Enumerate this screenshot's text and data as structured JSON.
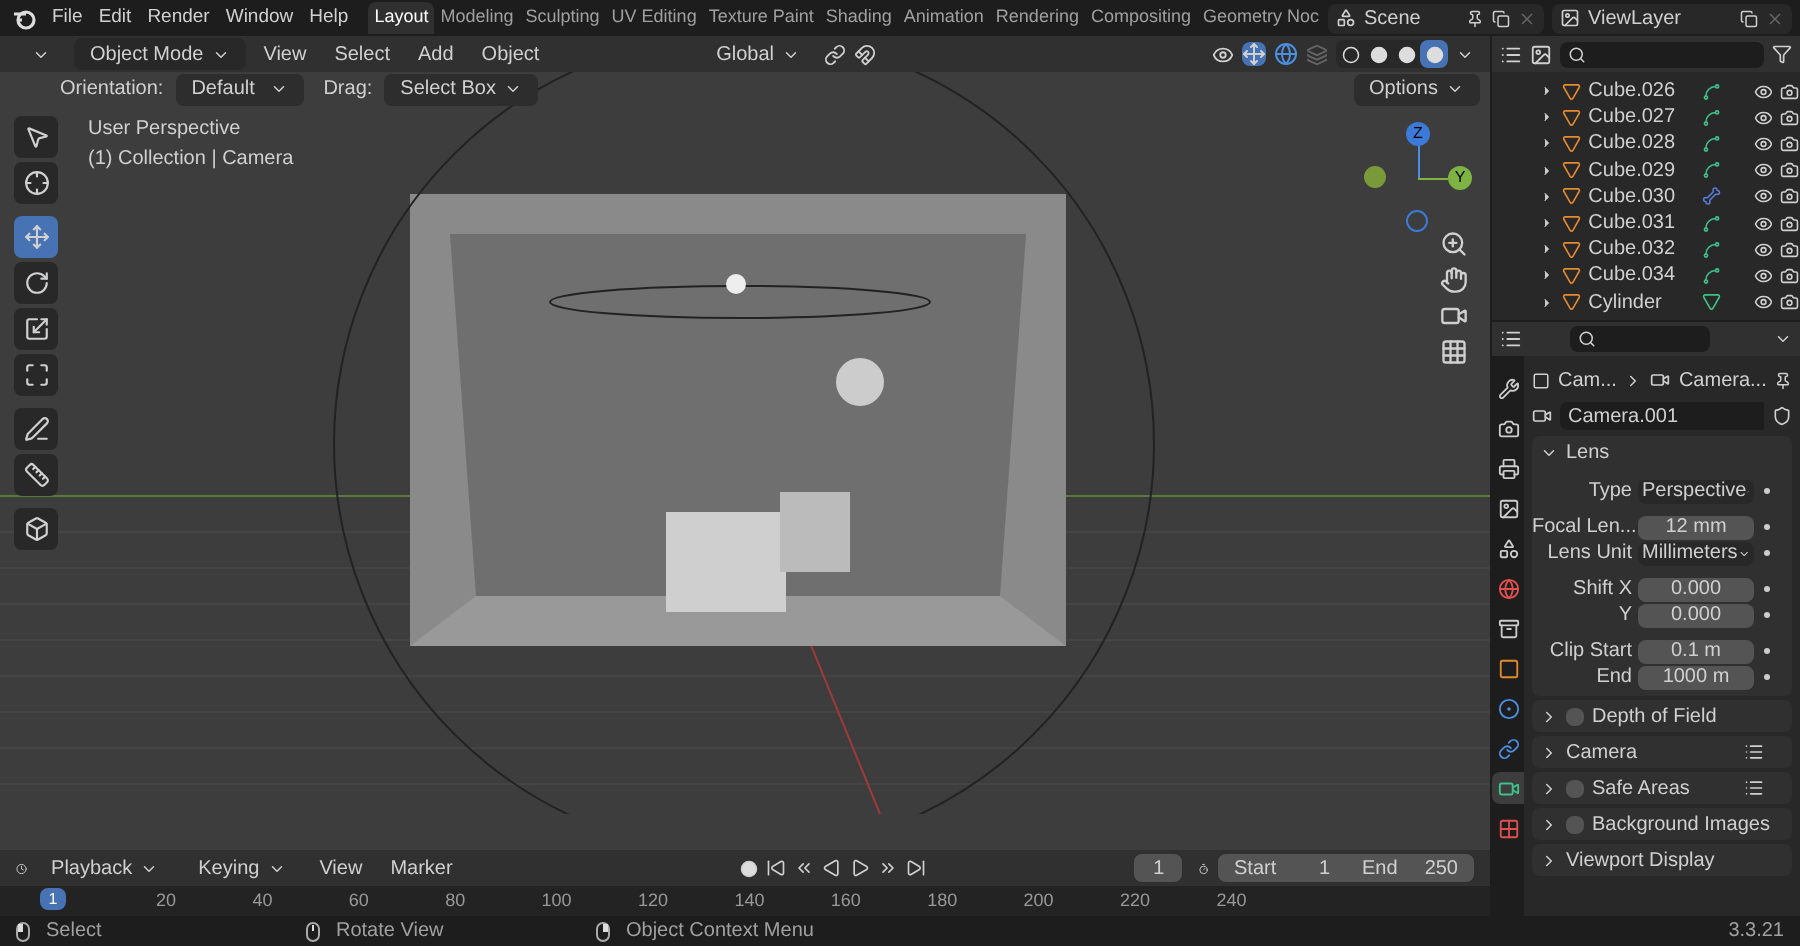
{
  "menu": [
    "File",
    "Edit",
    "Render",
    "Window",
    "Help"
  ],
  "workspaces": [
    {
      "label": "Layout",
      "selected": true
    },
    {
      "label": "Modeling",
      "selected": false
    },
    {
      "label": "Sculpting",
      "selected": false
    },
    {
      "label": "UV Editing",
      "selected": false
    },
    {
      "label": "Texture Paint",
      "selected": false
    },
    {
      "label": "Shading",
      "selected": false
    },
    {
      "label": "Animation",
      "selected": false
    },
    {
      "label": "Rendering",
      "selected": false
    },
    {
      "label": "Compositing",
      "selected": false
    },
    {
      "label": "Geometry Noc",
      "selected": false
    }
  ],
  "scene": "Scene",
  "view_layer": "ViewLayer",
  "viewport_header": {
    "mode": "Object Mode",
    "menus": [
      "View",
      "Select",
      "Add",
      "Object"
    ],
    "orientation": "Global",
    "shading": [
      {
        "kind": "wireframe",
        "selected": false
      },
      {
        "kind": "solid",
        "selected": false
      },
      {
        "kind": "material",
        "selected": false
      },
      {
        "kind": "rendered",
        "selected": true
      }
    ]
  },
  "tool_settings": {
    "orientation_label": "Orientation:",
    "orientation": "Default",
    "drag_label": "Drag:",
    "drag": "Select Box",
    "options": "Options"
  },
  "viewport": {
    "view_name": "User Perspective",
    "collection": "(1) Collection | Camera",
    "axes": {
      "y": "Y",
      "z": "Z"
    }
  },
  "toolbar": [
    {
      "kind": "select",
      "selected": false
    },
    {
      "kind": "cursor",
      "selected": false
    },
    {
      "kind": "move",
      "selected": true
    },
    {
      "kind": "rotate",
      "selected": false
    },
    {
      "kind": "scale",
      "selected": false
    },
    {
      "kind": "transform",
      "selected": false
    },
    {
      "kind": "annotate",
      "selected": false
    },
    {
      "kind": "measure",
      "selected": false
    },
    {
      "kind": "add-cube",
      "selected": false
    }
  ],
  "outliner": [
    {
      "name": "Cube.026",
      "kind": "modifier"
    },
    {
      "name": "Cube.027",
      "kind": "modifier"
    },
    {
      "name": "Cube.028",
      "kind": "modifier"
    },
    {
      "name": "Cube.029",
      "kind": "modifier"
    },
    {
      "name": "Cube.030",
      "kind": "bone"
    },
    {
      "name": "Cube.031",
      "kind": "modifier"
    },
    {
      "name": "Cube.032",
      "kind": "modifier"
    },
    {
      "name": "Cube.034",
      "kind": "modifier"
    },
    {
      "name": "Cylinder",
      "kind": "mesh"
    }
  ],
  "property_tabs": [
    {
      "kind": "tool",
      "selected": false
    },
    {
      "kind": "render",
      "selected": false
    },
    {
      "kind": "output",
      "selected": false
    },
    {
      "kind": "view-layer",
      "selected": false
    },
    {
      "kind": "scene",
      "selected": false
    },
    {
      "kind": "world",
      "selected": false
    },
    {
      "kind": "collection",
      "selected": false
    },
    {
      "kind": "object",
      "selected": false
    },
    {
      "kind": "physics",
      "selected": false
    },
    {
      "kind": "constraints",
      "selected": false
    },
    {
      "kind": "data",
      "selected": true
    },
    {
      "kind": "texture",
      "selected": false
    }
  ],
  "properties": {
    "breadcrumb": [
      "Cam...",
      "Camera..."
    ],
    "datablock": "Camera.001",
    "lens": {
      "title": "Lens",
      "expanded": true,
      "groups": [
        [
          {
            "label": "Type",
            "value": "Perspective",
            "kind": "dropdown"
          }
        ],
        [
          {
            "label": "Focal Len...",
            "value": "12 mm",
            "kind": "number"
          },
          {
            "label": "Lens Unit",
            "value": "Millimeters",
            "kind": "dropdown"
          }
        ],
        [
          {
            "label": "Shift X",
            "value": "0.000",
            "kind": "number"
          },
          {
            "label": "Y",
            "value": "0.000",
            "kind": "number"
          }
        ],
        [
          {
            "label": "Clip Start",
            "value": "0.1 m",
            "kind": "number"
          },
          {
            "label": "End",
            "value": "1000 m",
            "kind": "number"
          }
        ]
      ]
    },
    "subpanels": [
      {
        "label": "Depth of Field",
        "expanded": false,
        "kind": "checkbox",
        "checked": false,
        "presets": false
      },
      {
        "label": "Camera",
        "expanded": false,
        "kind": "plain",
        "presets": true
      },
      {
        "label": "Safe Areas",
        "expanded": false,
        "kind": "checkbox",
        "checked": false,
        "presets": true
      },
      {
        "label": "Background Images",
        "expanded": false,
        "kind": "checkbox",
        "checked": false,
        "presets": false
      },
      {
        "label": "Viewport Display",
        "expanded": false,
        "kind": "plain",
        "presets": false
      }
    ]
  },
  "timeline": {
    "menus": [
      "Playback",
      "Keying",
      "View",
      "Marker"
    ],
    "current_frame": "1",
    "start_label": "Start",
    "start": "1",
    "end_label": "End",
    "end": "250",
    "playhead": "1",
    "ruler": [
      "20",
      "40",
      "60",
      "80",
      "100",
      "120",
      "140",
      "160",
      "180",
      "200",
      "220",
      "240"
    ]
  },
  "status": {
    "items": [
      {
        "label": "Select",
        "kind": "left"
      },
      {
        "label": "Rotate View",
        "kind": "middle"
      },
      {
        "label": "Object Context Menu",
        "kind": "right"
      }
    ],
    "version": "3.3.21"
  }
}
